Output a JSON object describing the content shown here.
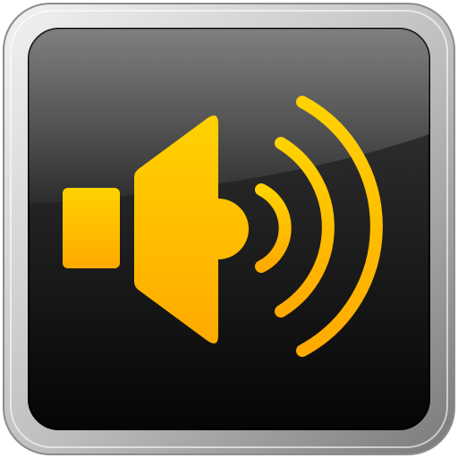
{
  "icon": {
    "name": "volume-speaker-icon",
    "colors": {
      "bezel_light": "#f2f2f2",
      "bezel_mid": "#bdbdbd",
      "bezel_dark": "#7a7a7a",
      "face_top": "#3a3a3a",
      "face_bottom": "#050505",
      "gloss": "#ffffff",
      "accent_top": "#ffd200",
      "accent_bottom": "#ffaa00"
    },
    "sound_waves": 3
  }
}
